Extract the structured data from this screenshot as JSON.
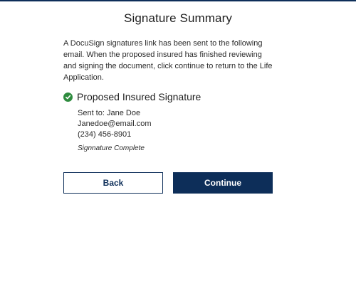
{
  "page": {
    "title": "Signature Summary",
    "intro": "A DocuSign signatures link has been sent to the following email. When the proposed insured has finished reviewing and signing the document, click continue to return to the Life Application."
  },
  "signature_section": {
    "icon": "check-circle-icon",
    "title": "Proposed Insured Signature",
    "sent_to": "Sent to: Jane Doe",
    "email": "Janedoe@email.com",
    "phone": "(234) 456-8901",
    "status": "Signnature Complete"
  },
  "actions": {
    "back_label": "Back",
    "continue_label": "Continue"
  },
  "colors": {
    "primary": "#0d2e59",
    "success": "#2e8b3e"
  }
}
